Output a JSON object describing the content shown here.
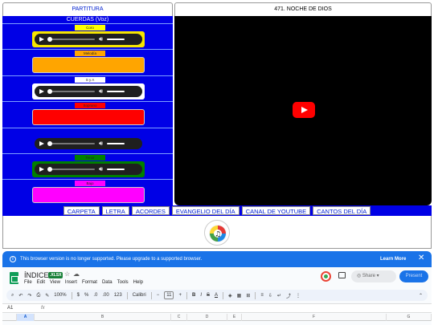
{
  "tabs": {
    "left": "PARTITURA",
    "right": "471. NOCHE DE DIOS"
  },
  "left_panel": {
    "title": "CUERDAS (Voz)",
    "rows": [
      {
        "label": "Coro",
        "label_bg": "#ffff00",
        "kind": "player",
        "frame": "#f7e600"
      },
      {
        "label": "Melodía",
        "label_bg": "#ffa500",
        "kind": "bar",
        "frame": "#ffa500"
      },
      {
        "label": "S y A",
        "label_bg": "#ffffff",
        "kind": "player",
        "frame": "#ffffff"
      },
      {
        "label": "Soprano",
        "label_bg": "#ff0000",
        "kind": "bar",
        "frame": "#ff0000"
      },
      {
        "label": "",
        "label_bg": "#0000e6",
        "kind": "player",
        "frame": "#0000e6"
      },
      {
        "label": "Tenor",
        "label_bg": "#008000",
        "kind": "player",
        "frame": "#008000"
      },
      {
        "label": "Bajo",
        "label_bg": "#ff00ff",
        "kind": "bar",
        "frame": "#ff00ff"
      }
    ]
  },
  "nav": [
    "CARPETA",
    "LETRA",
    "ACORDES",
    "EVANGELIO DEL DÍA",
    "CANAL DE YOUTUBE",
    "CANTOS DEL DÍA"
  ],
  "banner": {
    "text": "This browser version is no longer supported. Please upgrade to a supported browser.",
    "learn_more": "Learn More",
    "close": "✕"
  },
  "sheets": {
    "doc_title": "ÍNDICE",
    "badge": ".XLSX",
    "menus": [
      "File",
      "Edit",
      "View",
      "Insert",
      "Format",
      "Data",
      "Tools",
      "Help"
    ],
    "share": "Share",
    "present": "Present",
    "zoom": "100%",
    "currency": "$",
    "percent": "%",
    "dec_less": ".0",
    "dec_more": ".00",
    "num_fmt": "123",
    "font": "Calibri",
    "font_size": "11",
    "cell_ref": "A1",
    "fx": "fx",
    "columns": [
      "A",
      "B",
      "C",
      "D",
      "E",
      "F",
      "G"
    ]
  },
  "colors": {
    "panel_blue": "#0000e6",
    "banner_blue": "#1a73e8",
    "youtube_red": "#ff0000"
  }
}
